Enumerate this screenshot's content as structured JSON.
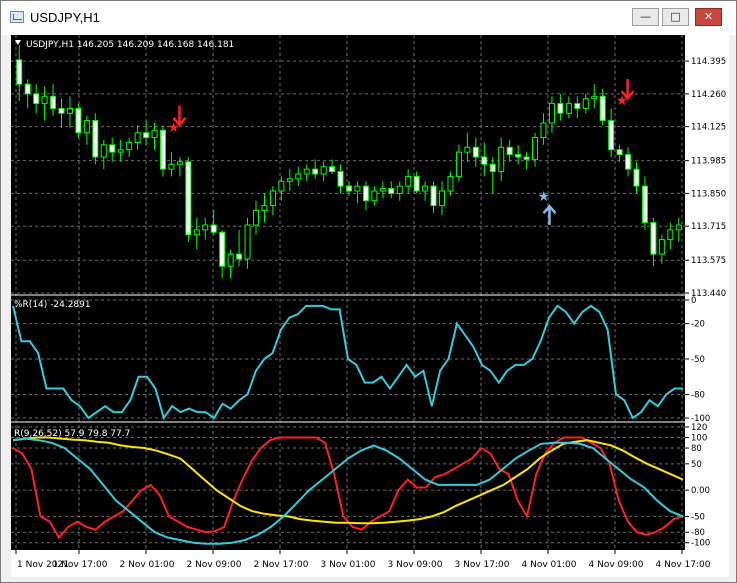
{
  "window": {
    "title": "USDJPY,H1",
    "buttons": [
      "minimize",
      "maximize",
      "close"
    ]
  },
  "main_panel": {
    "header": "USDJPY,H1  146.205 146.209 146.168 146.181",
    "price_ticks": [
      "114.395",
      "114.260",
      "114.125",
      "113.985",
      "113.850",
      "113.715",
      "113.575",
      "113.440"
    ]
  },
  "wpr_panel": {
    "header": "%R(14) -24.2891",
    "ticks": [
      "0",
      "-20",
      "-50",
      "-80",
      "-100"
    ]
  },
  "third_panel": {
    "header": "R(9,26,52) 57.9 79.8 77.7",
    "ticks": [
      "120",
      "100",
      "80",
      "50",
      "0.00",
      "-50",
      "-80",
      "-100"
    ]
  },
  "time_labels": [
    "1 Nov 2021",
    "1 Nov 17:00",
    "2 Nov 01:00",
    "2 Nov 09:00",
    "2 Nov 17:00",
    "3 Nov 01:00",
    "3 Nov 09:00",
    "3 Nov 17:00",
    "4 Nov 01:00",
    "4 Nov 09:00",
    "4 Nov 17:00"
  ],
  "colors": {
    "background": "#000000",
    "grid": "#6e6e6e",
    "candle": "#00ff00",
    "wpr_line": "#33ccdd",
    "line_red": "#ff2020",
    "line_yellow": "#ffe600",
    "line_cyan": "#33ccdd",
    "sell_arrow": "#ff2020",
    "buy_arrow": "#8ab4e8"
  },
  "chart_data": [
    {
      "type": "candlestick",
      "title": "USDJPY,H1",
      "ylim": [
        113.44,
        114.42
      ],
      "ohlc": [
        [
          114.4,
          114.46,
          114.23,
          114.3
        ],
        [
          114.3,
          114.32,
          114.2,
          114.26
        ],
        [
          114.26,
          114.3,
          114.18,
          114.22
        ],
        [
          114.22,
          114.29,
          114.15,
          114.25
        ],
        [
          114.25,
          114.3,
          114.17,
          114.2
        ],
        [
          114.2,
          114.24,
          114.12,
          114.18
        ],
        [
          114.18,
          114.25,
          114.12,
          114.2
        ],
        [
          114.2,
          114.22,
          114.08,
          114.1
        ],
        [
          114.1,
          114.17,
          114.05,
          114.15
        ],
        [
          114.15,
          114.18,
          113.97,
          114.0
        ],
        [
          114.0,
          114.07,
          113.95,
          114.05
        ],
        [
          114.05,
          114.08,
          113.98,
          114.02
        ],
        [
          114.02,
          114.07,
          113.98,
          114.03
        ],
        [
          114.03,
          114.08,
          114.0,
          114.06
        ],
        [
          114.06,
          114.13,
          114.03,
          114.1
        ],
        [
          114.1,
          114.15,
          114.05,
          114.08
        ],
        [
          114.08,
          114.14,
          114.03,
          114.11
        ],
        [
          114.11,
          114.13,
          113.92,
          113.95
        ],
        [
          113.95,
          114.02,
          113.92,
          113.97
        ],
        [
          113.97,
          114.0,
          113.92,
          113.98
        ],
        [
          113.98,
          114.0,
          113.65,
          113.68
        ],
        [
          113.68,
          113.75,
          113.62,
          113.7
        ],
        [
          113.7,
          113.75,
          113.66,
          113.72
        ],
        [
          113.72,
          113.78,
          113.68,
          113.69
        ],
        [
          113.69,
          113.7,
          113.5,
          113.55
        ],
        [
          113.55,
          113.62,
          113.5,
          113.6
        ],
        [
          113.6,
          113.7,
          113.55,
          113.58
        ],
        [
          113.58,
          113.75,
          113.54,
          113.72
        ],
        [
          113.72,
          113.82,
          113.68,
          113.78
        ],
        [
          113.78,
          113.85,
          113.73,
          113.8
        ],
        [
          113.8,
          113.88,
          113.76,
          113.86
        ],
        [
          113.86,
          113.92,
          113.82,
          113.9
        ],
        [
          113.9,
          113.95,
          113.86,
          113.91
        ],
        [
          113.91,
          113.96,
          113.88,
          113.93
        ],
        [
          113.93,
          113.97,
          113.9,
          113.95
        ],
        [
          113.95,
          113.99,
          113.91,
          113.93
        ],
        [
          113.93,
          113.98,
          113.9,
          113.96
        ],
        [
          113.96,
          113.99,
          113.93,
          113.94
        ],
        [
          113.94,
          113.97,
          113.85,
          113.88
        ],
        [
          113.88,
          113.9,
          113.84,
          113.86
        ],
        [
          113.86,
          113.9,
          113.81,
          113.88
        ],
        [
          113.88,
          113.9,
          113.78,
          113.82
        ],
        [
          113.82,
          113.88,
          113.8,
          113.86
        ],
        [
          113.86,
          113.9,
          113.83,
          113.87
        ],
        [
          113.87,
          113.9,
          113.83,
          113.85
        ],
        [
          113.85,
          113.9,
          113.82,
          113.88
        ],
        [
          113.88,
          113.95,
          113.85,
          113.92
        ],
        [
          113.92,
          113.94,
          113.85,
          113.86
        ],
        [
          113.86,
          113.9,
          113.82,
          113.88
        ],
        [
          113.88,
          113.9,
          113.77,
          113.8
        ],
        [
          113.8,
          113.9,
          113.76,
          113.86
        ],
        [
          113.86,
          113.94,
          113.84,
          113.92
        ],
        [
          113.92,
          114.05,
          113.9,
          114.02
        ],
        [
          114.02,
          114.1,
          113.98,
          114.04
        ],
        [
          114.04,
          114.08,
          113.96,
          114.0
        ],
        [
          114.0,
          114.06,
          113.92,
          113.97
        ],
        [
          113.97,
          114.0,
          113.85,
          113.94
        ],
        [
          113.94,
          114.08,
          113.9,
          114.04
        ],
        [
          114.04,
          114.07,
          113.98,
          114.01
        ],
        [
          114.01,
          114.05,
          113.97,
          114.0
        ],
        [
          114.0,
          114.02,
          113.95,
          113.99
        ],
        [
          113.99,
          114.1,
          113.96,
          114.08
        ],
        [
          114.08,
          114.18,
          114.05,
          114.14
        ],
        [
          114.14,
          114.25,
          114.1,
          114.22
        ],
        [
          114.22,
          114.26,
          114.15,
          114.18
        ],
        [
          114.18,
          114.25,
          114.16,
          114.22
        ],
        [
          114.22,
          114.25,
          114.16,
          114.2
        ],
        [
          114.2,
          114.26,
          114.18,
          114.24
        ],
        [
          114.24,
          114.3,
          114.2,
          114.25
        ],
        [
          114.25,
          114.28,
          114.13,
          114.15
        ],
        [
          114.15,
          114.2,
          114.0,
          114.03
        ],
        [
          114.03,
          114.05,
          113.98,
          114.01
        ],
        [
          114.01,
          114.04,
          113.92,
          113.95
        ],
        [
          113.95,
          113.98,
          113.85,
          113.88
        ],
        [
          113.88,
          113.92,
          113.7,
          113.73
        ],
        [
          113.73,
          113.75,
          113.55,
          113.6
        ],
        [
          113.6,
          113.68,
          113.56,
          113.66
        ],
        [
          113.66,
          113.73,
          113.62,
          113.7
        ],
        [
          113.7,
          113.75,
          113.65,
          113.72
        ]
      ],
      "annotations": [
        {
          "label": "sell-arrow",
          "bar": 18,
          "price": 114.12
        },
        {
          "label": "buy-arrow",
          "bar": 62,
          "price": 113.81
        },
        {
          "label": "sell-arrow",
          "bar": 71,
          "price": 114.23
        }
      ]
    },
    {
      "type": "line",
      "title": "%R(14) -24.2891",
      "ylim": [
        -100,
        0
      ],
      "series": [
        {
          "values": [
            -5,
            -35,
            -35,
            -45,
            -75,
            -75,
            -75,
            -85,
            -90,
            -100,
            -95,
            -90,
            -95,
            -95,
            -85,
            -65,
            -65,
            -75,
            -100,
            -90,
            -95,
            -92,
            -95,
            -95,
            -100,
            -88,
            -92,
            -85,
            -80,
            -60,
            -50,
            -45,
            -25,
            -15,
            -12,
            -5,
            -5,
            -5,
            -8,
            -8,
            -50,
            -55,
            -70,
            -70,
            -65,
            -75,
            -65,
            -55,
            -65,
            -60,
            -90,
            -60,
            -50,
            -20,
            -30,
            -40,
            -55,
            -60,
            -70,
            -60,
            -55,
            -55,
            -50,
            -35,
            -15,
            -5,
            -10,
            -20,
            -10,
            -5,
            -10,
            -25,
            -80,
            -85,
            -100,
            -95,
            -85,
            -90,
            -80,
            -75,
            -75
          ]
        }
      ]
    },
    {
      "type": "line",
      "title": "R(9,26,52) 57.9 79.8 77.7",
      "ylim": [
        -110,
        120
      ],
      "series": [
        {
          "color": "red",
          "values": [
            80,
            70,
            40,
            -50,
            -60,
            -90,
            -70,
            -60,
            -70,
            -75,
            -60,
            -50,
            -40,
            -20,
            0,
            10,
            -10,
            -50,
            -60,
            -70,
            -75,
            -80,
            -78,
            -70,
            -20,
            20,
            55,
            80,
            95,
            100,
            100,
            100,
            100,
            100,
            90,
            30,
            -50,
            -70,
            -75,
            -60,
            -50,
            -40,
            0,
            20,
            5,
            5,
            25,
            30,
            40,
            50,
            60,
            80,
            70,
            40,
            30,
            -20,
            -50,
            30,
            70,
            90,
            100,
            100,
            100,
            90,
            80,
            50,
            -20,
            -60,
            -80,
            -85,
            -80,
            -70,
            -55,
            -50
          ]
        },
        {
          "color": "yellow",
          "values": [
            95,
            98,
            100,
            100,
            98,
            96,
            95,
            92,
            90,
            85,
            82,
            80,
            75,
            68,
            60,
            40,
            20,
            0,
            -15,
            -30,
            -40,
            -45,
            -48,
            -50,
            -55,
            -58,
            -60,
            -62,
            -62,
            -63,
            -63,
            -62,
            -60,
            -58,
            -55,
            -50,
            -42,
            -30,
            -20,
            -10,
            0,
            10,
            25,
            40,
            60,
            75,
            88,
            92,
            95,
            90,
            85,
            75,
            62,
            50,
            40,
            30,
            20
          ]
        },
        {
          "color": "cyan",
          "values": [
            95,
            98,
            95,
            90,
            80,
            60,
            40,
            10,
            -20,
            -40,
            -60,
            -80,
            -90,
            -95,
            -100,
            -102,
            -102,
            -100,
            -95,
            -85,
            -70,
            -50,
            -25,
            0,
            20,
            40,
            60,
            75,
            85,
            75,
            60,
            40,
            20,
            10,
            10,
            10,
            10,
            20,
            40,
            60,
            75,
            88,
            90,
            90,
            88,
            80,
            60,
            40,
            20,
            5,
            -20,
            -40,
            -50
          ]
        }
      ]
    }
  ]
}
